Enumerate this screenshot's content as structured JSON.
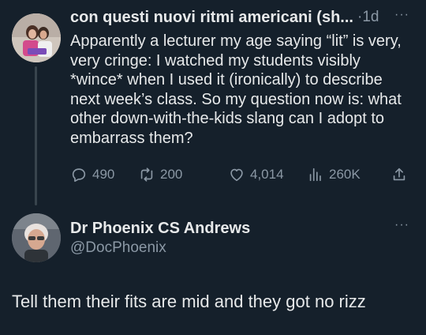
{
  "post": {
    "author_name": "con questi nuovi ritmi americani (sh...",
    "separator": "·",
    "time": "1d",
    "more": "···",
    "text": "Apparently a lecturer my age saying “lit” is very, very cringe: I watched my students visibly *wince* when I used it (ironically) to describe next week’s class. So my question now is: what other down-with-the-kids slang can I adopt to embarrass them?",
    "replies": "490",
    "reposts": "200",
    "likes": "4,014",
    "views": "260K"
  },
  "reply": {
    "author_name": "Dr Phoenix CS Andrews",
    "handle": "@DocPhoenix",
    "more": "···",
    "text": "Tell them their fits are mid and they got no rizz"
  },
  "colors": {
    "background": "#15202b",
    "text": "#e7e9ea",
    "muted": "#8b98a5",
    "thread_line": "#38444d"
  }
}
